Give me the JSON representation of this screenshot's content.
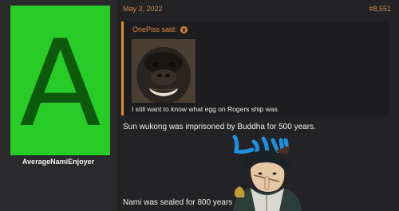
{
  "user": {
    "avatar_letter": "A",
    "username": "AverageNamiEnjoyer"
  },
  "post": {
    "date": "May 3, 2022",
    "post_number": "#8,551",
    "quote": {
      "author_label": "OnePiss said:",
      "text": "I still want to know what egg on Rogers ship was"
    },
    "line1": "Sun wukong was imprisoned by Buddha for 500 years.",
    "line2": "Nami was sealed for 800 years"
  },
  "colors": {
    "accent": "#e0883c",
    "avatar_bg": "#27cc27",
    "avatar_letter": "#0d5a0d"
  },
  "icons": {
    "quote_jump": "arrow-up-circle-icon"
  }
}
